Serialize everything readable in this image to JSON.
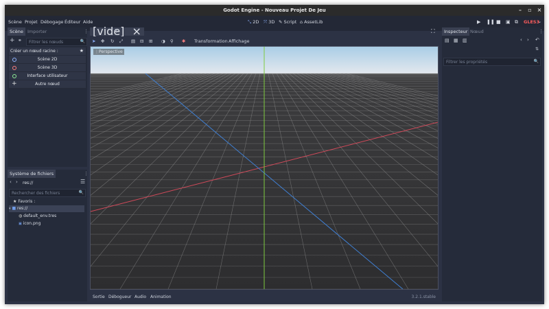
{
  "window": {
    "title": "Godot Engine - Nouveau Projet De Jeu"
  },
  "menu": [
    "Scène",
    "Projet",
    "Débogage",
    "Éditeur",
    "Aide"
  ],
  "modes": [
    {
      "label": "2D",
      "icon": "2d-icon"
    },
    {
      "label": "3D",
      "icon": "3d-icon"
    },
    {
      "label": "Script",
      "icon": "script-icon"
    },
    {
      "label": "AssetLib",
      "icon": "assetlib-icon"
    }
  ],
  "renderer": "GLES3",
  "scene_dock": {
    "tabs": [
      "Scène",
      "Importer"
    ],
    "filter_placeholder": "Filtrer les nœuds",
    "create_root_label": "Créer un nœud racine :",
    "root_options": [
      {
        "label": "Scène 2D",
        "color": "#8fb3ff"
      },
      {
        "label": "Scène 3D",
        "color": "#fc7f7f"
      },
      {
        "label": "Interface utilisateur",
        "color": "#8eef97"
      },
      {
        "label": "Autre nœud",
        "color": "#e0e0e0"
      }
    ]
  },
  "filesystem": {
    "tab": "Système de fichiers",
    "path": "res://",
    "search_placeholder": "Rechercher des fichiers",
    "favorites": "Favoris :",
    "root": "res://",
    "files": [
      "default_env.tres",
      "icon.png"
    ]
  },
  "editor": {
    "scene_tab": "[vide]",
    "toolbar_menus": [
      "Transformation",
      "Affichage"
    ],
    "perspective_label": "Perspective",
    "bottom_tabs": [
      "Sortie",
      "Débogueur",
      "Audio",
      "Animation"
    ],
    "version": "3.2.1.stable"
  },
  "inspector": {
    "tabs": [
      "Inspecteur",
      "Nœud"
    ],
    "filter_placeholder": "Filtrer les propriétés"
  },
  "colors": {
    "x_axis": "#d24a5a",
    "y_axis": "#7ecb3f",
    "z_axis": "#3f7fd2",
    "accent": "#8fb3ff"
  }
}
